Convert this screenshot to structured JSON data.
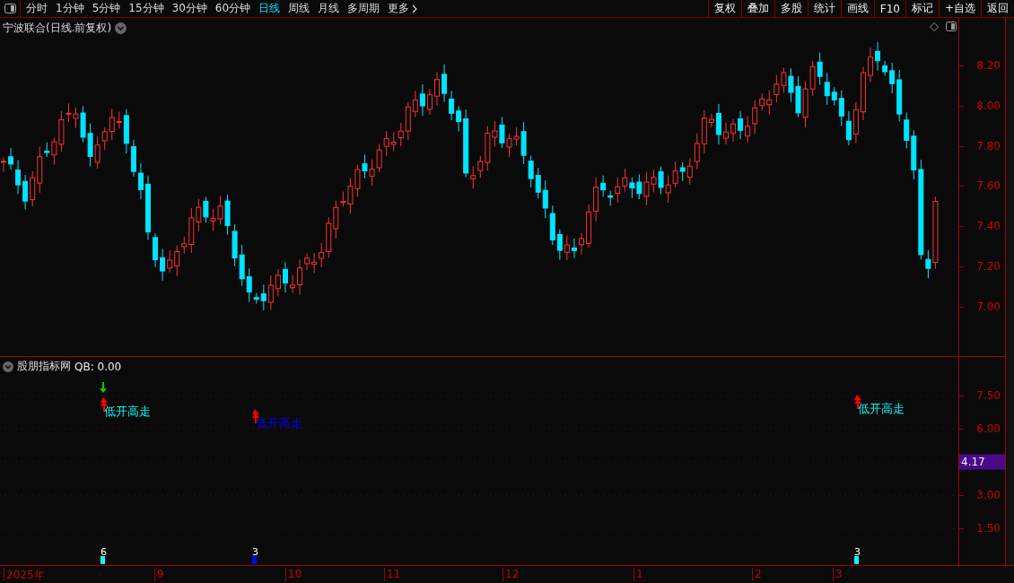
{
  "toolbar": {
    "periods": [
      {
        "label": "分时",
        "selected": false
      },
      {
        "label": "1分钟",
        "selected": false
      },
      {
        "label": "5分钟",
        "selected": false
      },
      {
        "label": "15分钟",
        "selected": false
      },
      {
        "label": "30分钟",
        "selected": false
      },
      {
        "label": "60分钟",
        "selected": false
      },
      {
        "label": "日线",
        "selected": true
      },
      {
        "label": "周线",
        "selected": false
      },
      {
        "label": "月线",
        "selected": false
      },
      {
        "label": "多周期",
        "selected": false
      },
      {
        "label": "更多",
        "selected": false
      }
    ],
    "buttons": [
      "复权",
      "叠加",
      "多股",
      "统计",
      "画线",
      "F10",
      "标记",
      "+自选",
      "返回"
    ]
  },
  "chart": {
    "title": "宁波联合(日线.前复权)",
    "price_ticks": [
      "8.20",
      "8.00",
      "7.80",
      "7.60",
      "7.40",
      "7.20",
      "7.00"
    ]
  },
  "indicator": {
    "name": "股朋指标网",
    "reading": "QB: 0.00",
    "ticks": [
      "7.50",
      "6.00",
      "3.00",
      "1.50"
    ],
    "current": "4.17",
    "signals": [
      {
        "text": "低开高走",
        "color": "#00ffff",
        "count": "6",
        "down_arrow": true
      },
      {
        "text": "低开高走",
        "color": "#0000ff",
        "count": "3",
        "down_arrow": false
      },
      {
        "text": "低开高走",
        "color": "#00ffff",
        "count": "3",
        "down_arrow": false
      }
    ]
  },
  "time_axis": [
    "2025年",
    "9",
    "10",
    "11",
    "12",
    "1",
    "2",
    "3"
  ]
}
